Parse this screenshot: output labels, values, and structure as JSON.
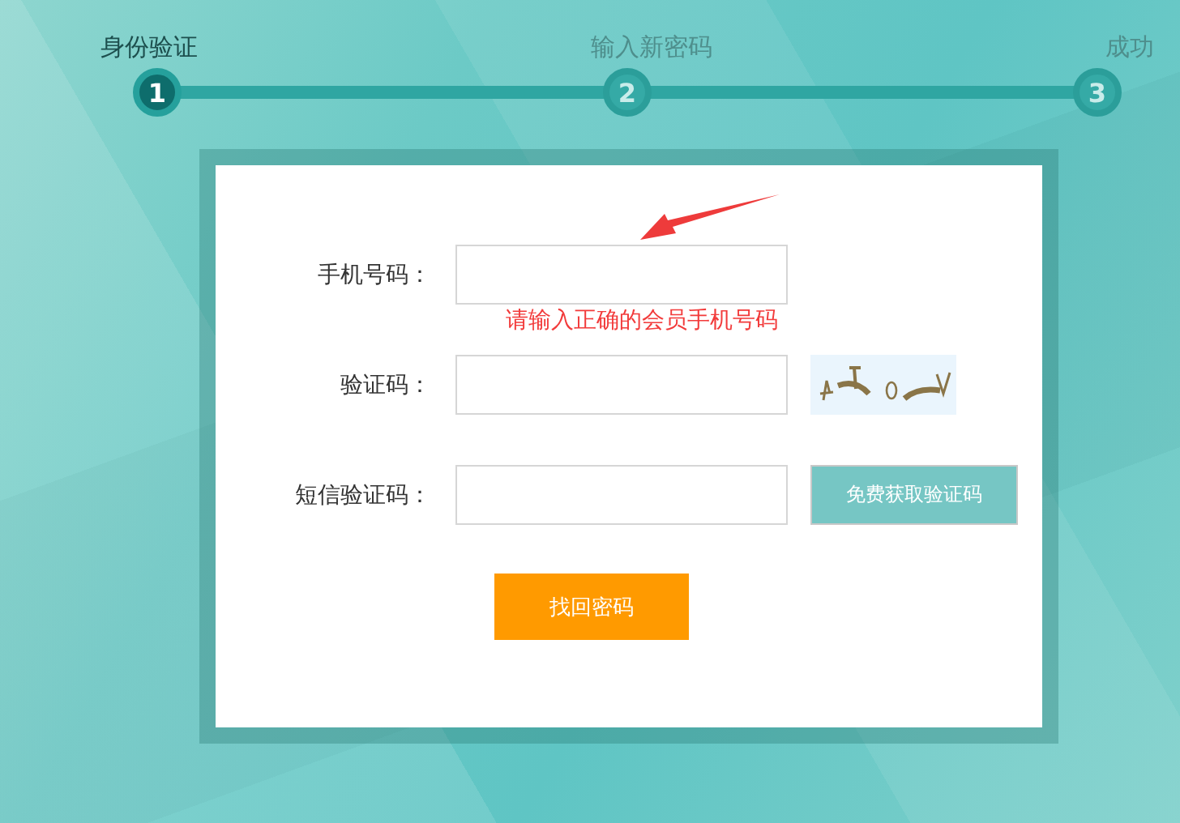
{
  "steps": [
    {
      "label": "身份验证",
      "number": "1",
      "selected": true
    },
    {
      "label": "输入新密码",
      "number": "2",
      "selected": false
    },
    {
      "label": "成功",
      "number": "3",
      "selected": false
    }
  ],
  "form": {
    "rows": [
      {
        "kind": "phone",
        "label": "手机号码：",
        "error": "请输入正确的会员手机号码"
      },
      {
        "kind": "captcha",
        "label": "验证码："
      },
      {
        "kind": "sms",
        "label": "短信验证码：",
        "button": "免费获取验证码"
      }
    ],
    "submit": "找回密码"
  }
}
